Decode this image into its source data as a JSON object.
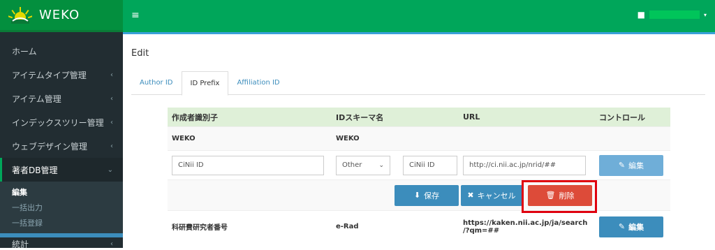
{
  "app": {
    "logo_text": "WEKO"
  },
  "topbar": {
    "user_name": ""
  },
  "sidebar": {
    "items": [
      {
        "label": "ホーム"
      },
      {
        "label": "アイテムタイプ管理"
      },
      {
        "label": "アイテム管理"
      },
      {
        "label": "インデックスツリー管理"
      },
      {
        "label": "ウェブデザイン管理"
      },
      {
        "label": "著者DB管理"
      },
      {
        "label": "統計"
      }
    ],
    "sub_items": [
      {
        "label": "編集"
      },
      {
        "label": "一括出力"
      },
      {
        "label": "一括登録"
      }
    ]
  },
  "page": {
    "title": "Edit"
  },
  "tabs": [
    {
      "label": "Author ID"
    },
    {
      "label": "ID Prefix"
    },
    {
      "label": "Affiliation ID"
    }
  ],
  "table": {
    "headers": [
      "作成者識別子",
      "IDスキーマ名",
      "URL",
      "コントロール"
    ],
    "row1": {
      "name": "WEKO",
      "scheme": "WEKO"
    },
    "edit_row": {
      "name_value": "CiNii ID",
      "scheme_select": "Other",
      "scheme_value": "CiNii ID",
      "url_value": "http://ci.nii.ac.jp/nrid/##",
      "edit_label": "編集"
    },
    "actions": {
      "save": "保存",
      "cancel": "キャンセル",
      "delete": "削除"
    },
    "row3": {
      "name": "科研費研究者番号",
      "scheme": "e-Rad",
      "url_line1": "https://kaken.nii.ac.jp/ja/search",
      "url_line2": "/?qm=##",
      "edit_label": "編集"
    }
  },
  "colors": {
    "topbar": "#00a65a",
    "sidebar": "#222d32",
    "primary": "#3c8dbc",
    "danger": "#dd4b39",
    "highlight": "#e0000f"
  },
  "icons": [
    "menu-icon",
    "user-icon",
    "chevron-left-icon",
    "chevron-down-icon",
    "edit-icon",
    "download-icon",
    "times-icon",
    "trash-icon"
  ]
}
